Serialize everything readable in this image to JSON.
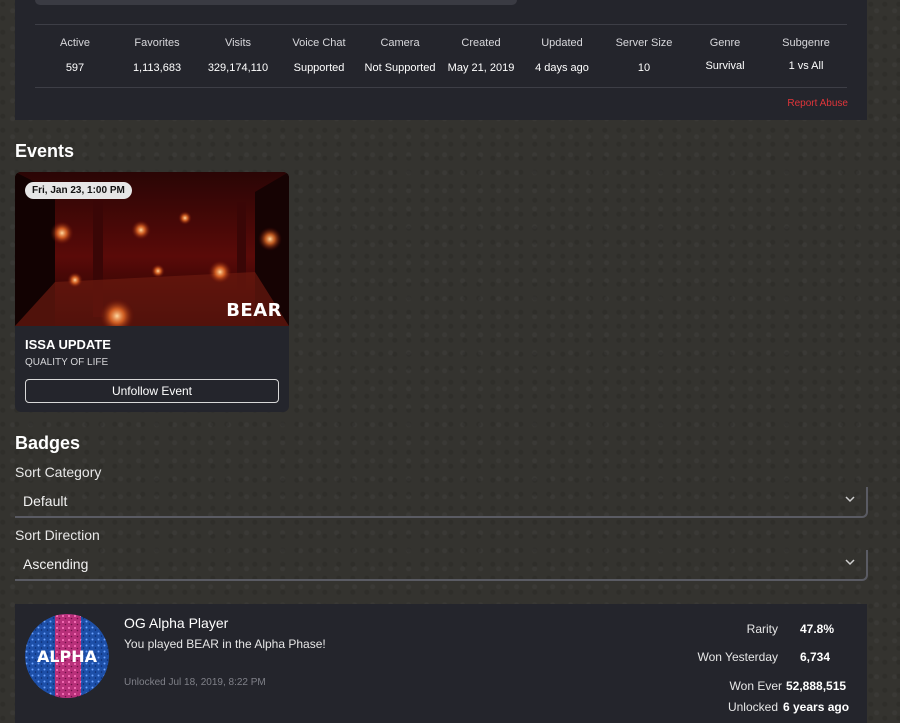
{
  "stats": {
    "columns": [
      {
        "label": "Active",
        "value": "597"
      },
      {
        "label": "Favorites",
        "value": "1,113,683"
      },
      {
        "label": "Visits",
        "value": "329,174,110"
      },
      {
        "label": "Voice Chat",
        "value": "Supported"
      },
      {
        "label": "Camera",
        "value": "Not Supported"
      },
      {
        "label": "Created",
        "value": "May 21, 2019"
      },
      {
        "label": "Updated",
        "value": "4 days ago"
      },
      {
        "label": "Server Size",
        "value": "10"
      },
      {
        "label": "Genre",
        "value": "Survival"
      },
      {
        "label": "Subgenre",
        "value": "1 vs All"
      }
    ],
    "report_abuse": "Report Abuse"
  },
  "events": {
    "title": "Events",
    "card": {
      "date": "Fri, Jan 23, 1:00 PM",
      "logo": "BEAR",
      "title": "ISSA UPDATE",
      "subtitle": "QUALITY OF LIFE",
      "button": "Unfollow Event"
    }
  },
  "badges": {
    "title": "Badges",
    "sort_category": {
      "label": "Sort Category",
      "value": "Default",
      "icon": "chevron-down-icon"
    },
    "sort_direction": {
      "label": "Sort Direction",
      "value": "Ascending",
      "icon": "chevron-down-icon"
    },
    "items": [
      {
        "icon_text": "ALPHA",
        "name": "OG Alpha Player",
        "description": "You played BEAR in the Alpha Phase!",
        "unlocked_at": "Unlocked Jul 18, 2019, 8:22 PM",
        "stats": {
          "rarity_label": "Rarity",
          "rarity": "47.8%",
          "won_yesterday_label": "Won Yesterday",
          "won_yesterday": "6,734",
          "won_ever_label": "Won Ever",
          "won_ever": "52,888,515",
          "unlocked_label": "Unlocked",
          "unlocked": "6 years ago"
        }
      }
    ]
  },
  "colors": {
    "panel": "#24252c",
    "background": "#34332f",
    "report_abuse": "#e0353a"
  }
}
